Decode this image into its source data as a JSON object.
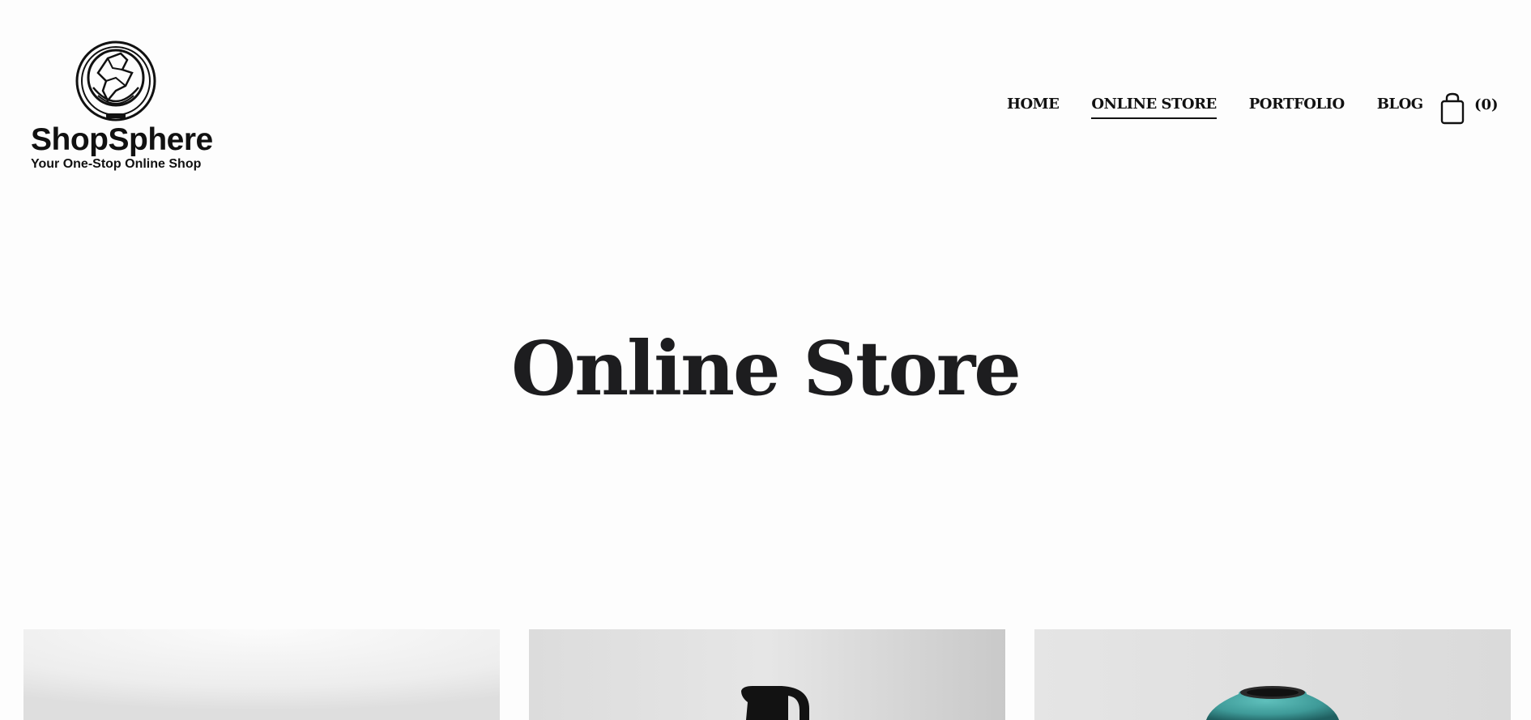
{
  "header": {
    "logo": {
      "name": "ShopSphere",
      "tagline": "Your One-Stop Online Shop",
      "icon": "globe-logo-icon"
    },
    "nav": [
      {
        "label": "HOME",
        "active": false
      },
      {
        "label": "ONLINE STORE",
        "active": true
      },
      {
        "label": "PORTFOLIO",
        "active": false
      },
      {
        "label": "BLOG",
        "active": false
      }
    ],
    "cart": {
      "icon": "shopping-bag-icon",
      "count_label": "(0)"
    }
  },
  "main": {
    "title": "Online Store",
    "products": [
      {
        "image": "white-backdrop-product-image"
      },
      {
        "image": "black-pitcher-product-image"
      },
      {
        "image": "teal-vase-product-image"
      }
    ]
  },
  "colors": {
    "background": "#fdfdfd",
    "text": "#1d1d1f",
    "vase_teal": "#3e9a98"
  }
}
